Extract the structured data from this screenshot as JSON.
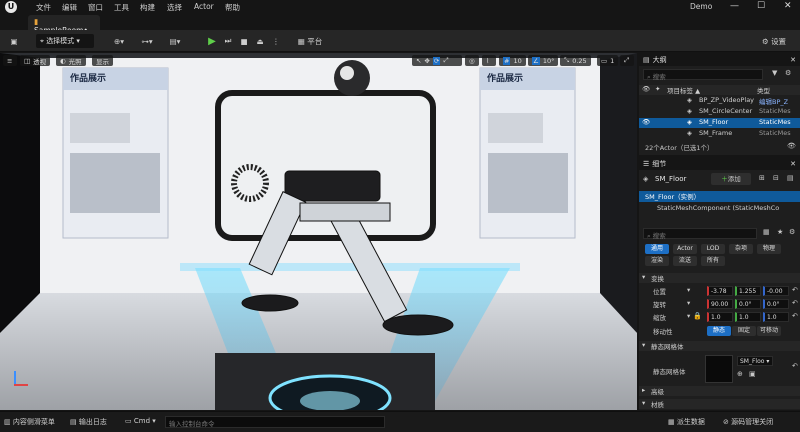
{
  "menubar": {
    "items": [
      "文件",
      "编辑",
      "窗口",
      "工具",
      "构建",
      "选择",
      "Actor",
      "帮助"
    ],
    "project": "Demo"
  },
  "tab": {
    "title": "SampleRoom•"
  },
  "toolbar": {
    "mode": "选择模式",
    "platform": "平台",
    "settings": "设置"
  },
  "viewport": {
    "view_label": "透视",
    "lit_label": "光照",
    "show_label": "显示",
    "grid_size": "10",
    "rot_snap": "10°",
    "scale_snap": "0.25",
    "camera_speed": "1",
    "poster_left_title": "作品展示",
    "poster_right_title": "作品展示"
  },
  "outliner": {
    "title": "大纲",
    "search_placeholder": "搜索",
    "col_label": "项目标签 ▲",
    "col_type": "类型",
    "rows": [
      {
        "label": "BP_ZP_VideoPlay",
        "type": "编辑BP_Z"
      },
      {
        "label": "SM_CircleCenter",
        "type": "StaticMes"
      },
      {
        "label": "SM_Floor",
        "type": "StaticMes"
      },
      {
        "label": "SM_Frame",
        "type": "StaticMes"
      }
    ],
    "count": "22个Actor（已选1个）"
  },
  "details": {
    "title": "细节",
    "actor_name": "SM_Floor",
    "add_label": "添加",
    "tree_root": "SM_Floor（实例）",
    "tree_child": "StaticMeshComponent (StaticMeshCo",
    "search_placeholder": "搜索",
    "filters_row1": [
      "通用",
      "Actor",
      "LOD",
      "杂项",
      "物理"
    ],
    "filters_row2": [
      "渲染",
      "流送",
      "所有"
    ],
    "section_transform": "变换",
    "location_label": "位置",
    "location": [
      "-3.78",
      "1.255",
      "-0.00"
    ],
    "rotation_label": "旋转",
    "rotation": [
      "90.00",
      "0.0°",
      "0.0°"
    ],
    "scale_label": "缩放",
    "scale": [
      "1.0",
      "1.0",
      "1.0"
    ],
    "mobility_label": "移动性",
    "mobility_options": [
      "静态",
      "固定",
      "可移动"
    ],
    "section_mesh": "静态网格体",
    "mesh_label": "静态网格体",
    "mesh_value": "SM_Floo",
    "section_advanced": "高级",
    "section_material": "材质"
  },
  "statusbar": {
    "content_drawer": "内容侧滑菜单",
    "output_log": "输出日志",
    "cmd": "Cmd",
    "cmd_placeholder": "输入控制台命令",
    "derived_data": "派生数据",
    "source_control": "源码管理关闭"
  }
}
